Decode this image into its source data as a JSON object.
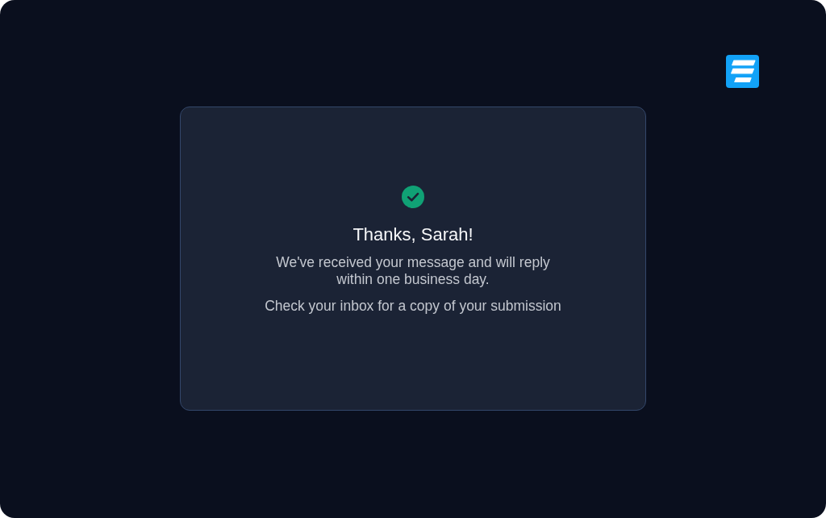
{
  "confirmation": {
    "title": "Thanks, Sarah!",
    "message": "We've received your message and will reply within one business day.",
    "note": "Check your inbox for a copy of your submission"
  }
}
